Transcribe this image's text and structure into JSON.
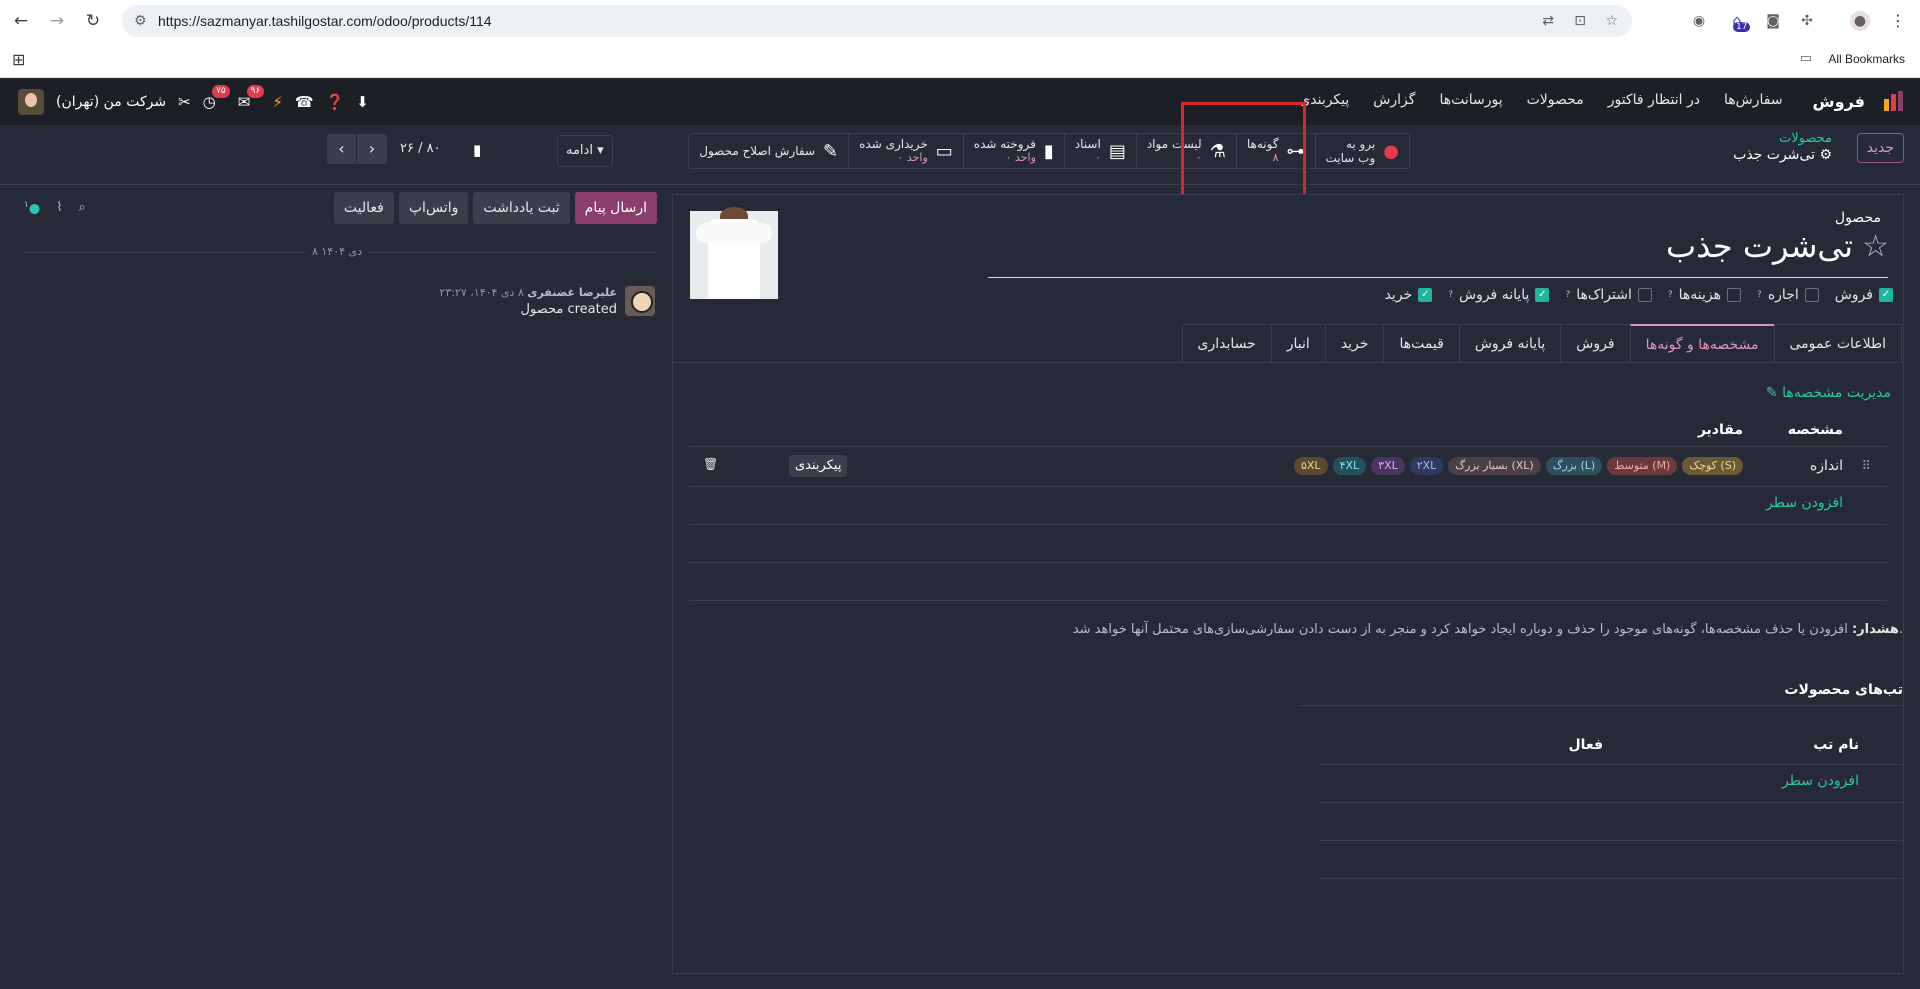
{
  "browser": {
    "url": "https://sazmanyar.tashilgostar.com/odoo/products/114",
    "all_bookmarks": "All Bookmarks",
    "ext_badge": "17"
  },
  "nav": {
    "app_name": "فروش",
    "menu": [
      "سفارش‌ها",
      "در انتظار فاکتور",
      "محصولات",
      "پورسانت‌ها",
      "گزارش",
      "پیکربندی"
    ],
    "company": "شرکت من (تهران)",
    "badge_activities": "۷۵",
    "badge_messages": "۹۶"
  },
  "control": {
    "new_label": "جدید",
    "breadcrumb_parent": "محصولات",
    "breadcrumb_current": "تی‌شرت جذب",
    "stats": [
      {
        "label": "برو به",
        "label2": "وب سایت",
        "value": "",
        "icon": "globe-icon"
      },
      {
        "label": "گونه‌ها",
        "value": "۸",
        "icon": "sitemap-icon"
      },
      {
        "label": "لیست مواد",
        "value": "۰",
        "icon": "flask-icon"
      },
      {
        "label": "اسناد",
        "value": "۰",
        "icon": "document-icon"
      },
      {
        "label": "فروخته شده",
        "value": "۰ واحد",
        "icon": "chart-icon"
      },
      {
        "label": "خریداری شده",
        "value": "۰ واحد",
        "icon": "card-icon"
      },
      {
        "label": "سفارش اصلاح محصول",
        "value": "",
        "icon": "wrench-icon"
      }
    ],
    "more_label": "ادامه",
    "pager": "۲۶ / ۸۰"
  },
  "chatter": {
    "send_message": "ارسال پیام",
    "log_note": "ثبت یادداشت",
    "whatsapp": "واتس‌اپ",
    "activity": "فعالیت",
    "followers_count": "۱",
    "date_separator": "۸ دی ۱۴۰۴",
    "message": {
      "author": "علیرضا غضنفری",
      "datetime": "۸ دی ۱۴۰۴، ۲۳:۲۷",
      "text": "محصول created"
    }
  },
  "form": {
    "field_label": "محصول",
    "product_name": "تی‌شرت جذب",
    "checkboxes": [
      {
        "label": "فروش",
        "checked": true,
        "help": false
      },
      {
        "label": "اجاره",
        "checked": false,
        "help": true
      },
      {
        "label": "هزینه‌ها",
        "checked": false,
        "help": true
      },
      {
        "label": "اشتراک‌ها",
        "checked": false,
        "help": true
      },
      {
        "label": "پایانه فروش",
        "checked": true,
        "help": true
      },
      {
        "label": "خرید",
        "checked": true,
        "help": false
      }
    ],
    "tabs": [
      "اطلاعات عمومی",
      "مشخصه‌ها و گونه‌ها",
      "فروش",
      "پایانه فروش",
      "قیمت‌ها",
      "خرید",
      "انبار",
      "حسابداری"
    ],
    "active_tab": 1,
    "manage_attributes": "مدیریت مشخصه‌ها",
    "attr_headers": {
      "attribute": "مشخصه",
      "values": "مقادیر"
    },
    "attribute_row": {
      "name": "اندازه",
      "values": [
        {
          "text": "کوچک (S)",
          "color": "#6b5a3a",
          "fg": "#f3d98a"
        },
        {
          "text": "متوسط (M)",
          "color": "#6b3a3a",
          "fg": "#f3a8a8"
        },
        {
          "text": "بزرگ (L)",
          "color": "#2f4f5c",
          "fg": "#9fdbe8"
        },
        {
          "text": "بسیار بزرگ (XL)",
          "color": "#4a3f45",
          "fg": "#e8c4cc"
        },
        {
          "text": "۲XL",
          "color": "#2f3a5c",
          "fg": "#a8b8f3"
        },
        {
          "text": "۳XL",
          "color": "#4a3560",
          "fg": "#d4b0f0"
        },
        {
          "text": "۴XL",
          "color": "#24525c",
          "fg": "#8ce0f0"
        },
        {
          "text": "۵XL",
          "color": "#5c4a30",
          "fg": "#f0d09a"
        }
      ],
      "configure": "پیکربندی"
    },
    "add_line": "افزودن سطر",
    "warning_bold": "هشدار:",
    "warning_text": " افزودن یا حذف مشخصه‌ها، گونه‌های موجود را حذف و دوباره ایجاد خواهد کرد و منجر به از دست دادن سفارشی‌سازی‌های محتمل آنها خواهد شد.",
    "product_tabs_title": "تب‌های محصولات",
    "tabs_headers": {
      "name": "نام تب",
      "active": "فعال"
    },
    "tabs_add_line": "افزودن سطر"
  }
}
